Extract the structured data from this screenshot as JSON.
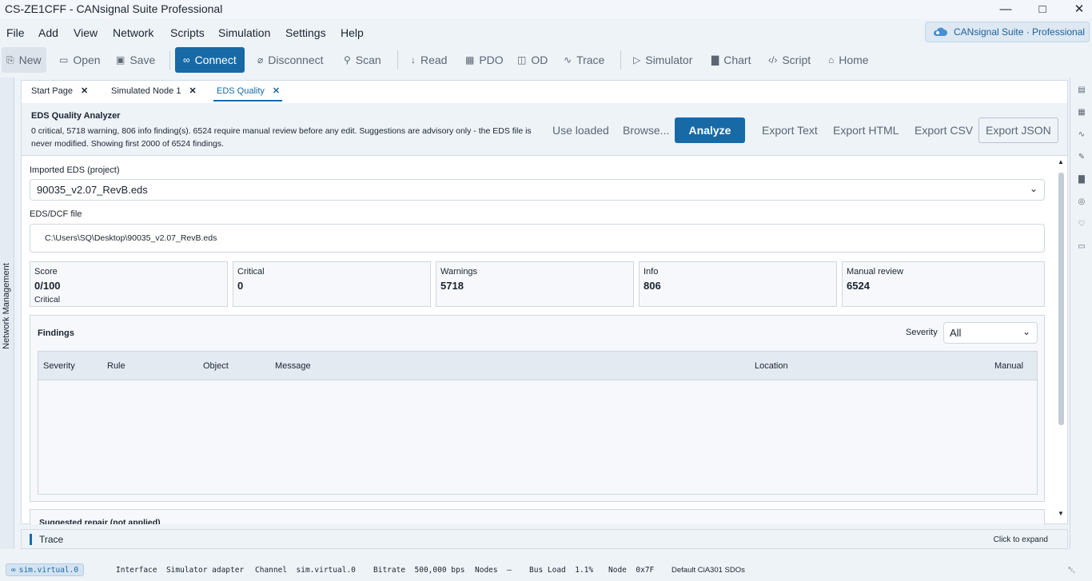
{
  "window": {
    "title": "CS-ZE1CFF - CANsignal Suite Professional"
  },
  "menu": [
    "File",
    "Add",
    "View",
    "Network",
    "Scripts",
    "Simulation",
    "Settings",
    "Help"
  ],
  "brand": {
    "text": "CANsignal Suite · Professional"
  },
  "toolbar": {
    "new": "New",
    "open": "Open",
    "save": "Save",
    "connect": "Connect",
    "disconnect": "Disconnect",
    "scan": "Scan",
    "read": "Read",
    "pdo": "PDO",
    "od": "OD",
    "trace": "Trace",
    "simulator": "Simulator",
    "chart": "Chart",
    "script": "Script",
    "home": "Home"
  },
  "left_panel": {
    "label": "Network Management"
  },
  "tabs": [
    {
      "label": "Start Page"
    },
    {
      "label": "Simulated Node 1"
    },
    {
      "label": "EDS Quality"
    }
  ],
  "analyzer": {
    "title": "EDS Quality Analyzer",
    "description": "0 critical, 5718 warning, 806 info finding(s). 6524 require manual review before any edit. Suggestions are advisory only - the EDS file is never modified. Showing first 2000 of 6524 findings.",
    "use_loaded": "Use loaded",
    "browse": "Browse...",
    "analyze": "Analyze",
    "export_text": "Export Text",
    "export_html": "Export HTML",
    "export_csv": "Export CSV",
    "export_json": "Export JSON"
  },
  "form": {
    "imported_label": "Imported EDS (project)",
    "imported_value": "90035_v2.07_RevB.eds",
    "file_label": "EDS/DCF file",
    "file_value": "C:\\Users\\SQ\\Desktop\\90035_v2.07_RevB.eds"
  },
  "summary": {
    "score": {
      "label": "Score",
      "value": "0/100",
      "sub": "Critical"
    },
    "critical": {
      "label": "Critical",
      "value": "0"
    },
    "warnings": {
      "label": "Warnings",
      "value": "5718"
    },
    "info": {
      "label": "Info",
      "value": "806"
    },
    "manual": {
      "label": "Manual review",
      "value": "6524"
    }
  },
  "findings": {
    "title": "Findings",
    "severity_label": "Severity",
    "severity_value": "All",
    "columns": [
      "Severity",
      "Rule",
      "Object",
      "Message",
      "Location",
      "Manual"
    ],
    "rows": []
  },
  "repair": {
    "title": "Suggested repair (not applied)"
  },
  "trace": {
    "title": "Trace",
    "hint": "Click to expand"
  },
  "status": {
    "chip": "sim.virtual.0",
    "interface_label": "Interface",
    "interface_value": "Simulator adapter",
    "channel_label": "Channel",
    "channel_value": "sim.virtual.0",
    "bitrate_label": "Bitrate",
    "bitrate_value": "500,000 bps",
    "nodes_label": "Nodes",
    "nodes_value": "–",
    "busload_label": "Bus Load",
    "busload_value": "1.1%",
    "node_label": "Node",
    "node_value": "0x7F",
    "sdo": "Default CiA301 SDOs"
  },
  "colors": {
    "accent": "#176aa6",
    "background": "#eef3f8"
  }
}
